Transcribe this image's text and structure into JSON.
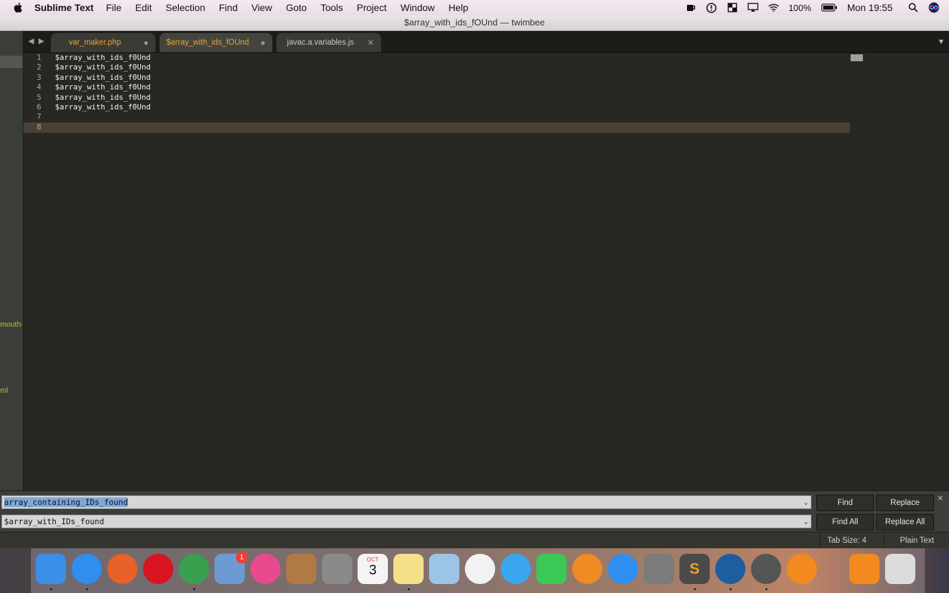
{
  "menubar": {
    "app_name": "Sublime Text",
    "menus": [
      "File",
      "Edit",
      "Selection",
      "Find",
      "View",
      "Goto",
      "Tools",
      "Project",
      "Window",
      "Help"
    ],
    "battery": "100%",
    "clock": "Mon 19:55"
  },
  "window": {
    "title": "$array_with_ids_fOUnd — twimbee"
  },
  "sidebar": {
    "fragments": [
      "mouth-",
      "ml"
    ]
  },
  "tabs": [
    {
      "label": "var_maker.php",
      "state": "dirty"
    },
    {
      "label": "$array_with_ids_fOUnd",
      "state": "dirty"
    },
    {
      "label": "javac.a.variables.js",
      "state": "close"
    }
  ],
  "editor": {
    "line_numbers": [
      "1",
      "2",
      "3",
      "4",
      "5",
      "6",
      "7",
      "8"
    ],
    "lines": [
      "$array_with_ids_f0Und",
      "$array_with_ids_f0Und",
      "$array_with_ids_f0Und",
      "$array_with_ids_f0Und",
      "$array_with_ids_f0Und",
      "$array_with_ids_f0Und",
      "",
      ""
    ],
    "current_line": 8
  },
  "find_panel": {
    "find_value": "array_containing_IDs_found",
    "replace_value": "$array_with_IDs_found",
    "find_label": "Find",
    "replace_label": "Replace",
    "find_all_label": "Find All",
    "replace_all_label": "Replace All"
  },
  "statusbar": {
    "tab_size": "Tab Size: 4",
    "syntax": "Plain Text"
  },
  "dock": {
    "items": [
      {
        "name": "finder",
        "color": "#3b8fe8"
      },
      {
        "name": "safari",
        "color": "#2f8ef0"
      },
      {
        "name": "firefox",
        "color": "#e8602a"
      },
      {
        "name": "opera",
        "color": "#d7141f"
      },
      {
        "name": "chrome",
        "color": "#38a04f"
      },
      {
        "name": "mail-bird",
        "color": "#6c9bd3",
        "badge": "1"
      },
      {
        "name": "itunes",
        "color": "#e84a8f"
      },
      {
        "name": "contacts",
        "color": "#b07a45"
      },
      {
        "name": "calculator",
        "color": "#8a8a8a"
      },
      {
        "name": "calendar",
        "color": "#f4f4f4"
      },
      {
        "name": "notes",
        "color": "#f4e18a"
      },
      {
        "name": "preview",
        "color": "#9cc4e4"
      },
      {
        "name": "photos",
        "color": "#f2f2f2"
      },
      {
        "name": "messages",
        "color": "#3aa6f0"
      },
      {
        "name": "facetime",
        "color": "#3cc854"
      },
      {
        "name": "ibooks",
        "color": "#f08a24"
      },
      {
        "name": "app-store",
        "color": "#2f8ef0"
      },
      {
        "name": "system-preferences",
        "color": "#7b7b7b"
      },
      {
        "name": "sublime-text",
        "color": "#4a4a4a"
      },
      {
        "name": "sourcetree",
        "color": "#1f5e9e"
      },
      {
        "name": "sequel-pro",
        "color": "#555555"
      },
      {
        "name": "squash",
        "color": "#f28a1f"
      },
      {
        "name": "squash-folder",
        "color": "#f28a1f"
      },
      {
        "name": "trash",
        "color": "#dcdcdc"
      }
    ],
    "calendar_month": "OCT",
    "calendar_day": "3",
    "sublime_glyph": "S"
  }
}
